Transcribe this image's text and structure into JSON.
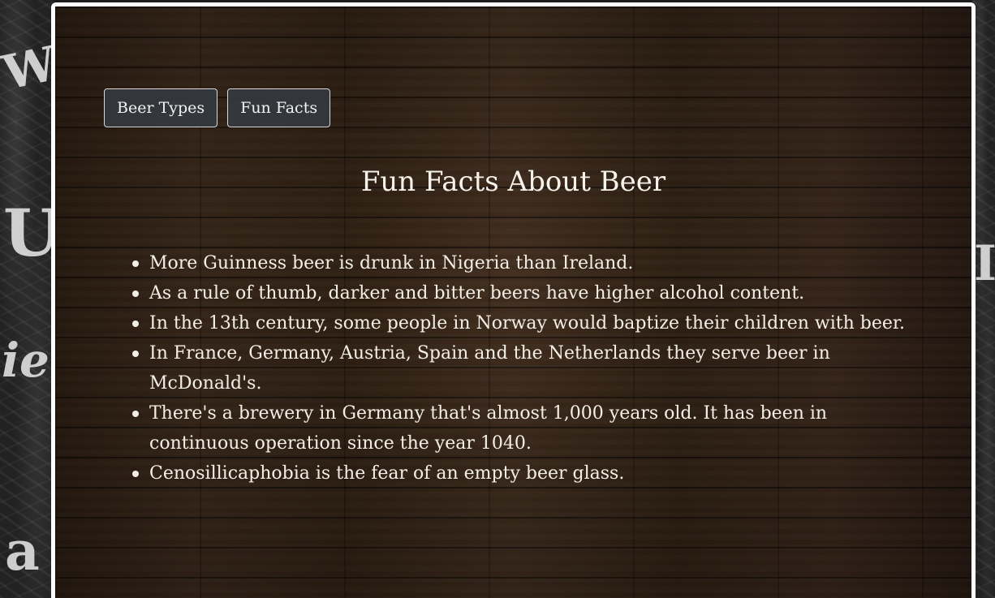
{
  "nav": {
    "items": [
      {
        "label": "Beer Types"
      },
      {
        "label": "Fun Facts"
      }
    ]
  },
  "page": {
    "title": "Fun Facts About Beer"
  },
  "facts": [
    "More Guinness beer is drunk in Nigeria than Ireland.",
    "As a rule of thumb, darker and bitter beers have higher alcohol content.",
    "In the 13th century, some people in Norway would baptize their children with beer.",
    "In France, Germany, Austria, Spain and the Netherlands they serve beer in McDonald's.",
    "There's a brewery in Germany that's almost 1,000 years old. It has been in continuous operation since the year 1040.",
    "Cenosillicaphobia is the fear of an empty beer glass."
  ],
  "colors": {
    "panel_border": "#ffffff",
    "button_bg": "#343a40",
    "text": "#f4efe6",
    "wood": "#4a3322"
  }
}
